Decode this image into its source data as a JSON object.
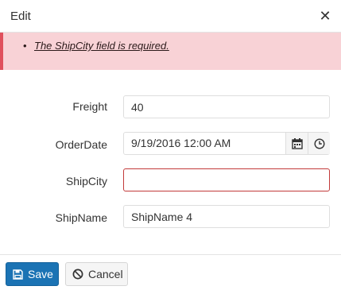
{
  "dialog": {
    "title": "Edit",
    "close_icon": "close-icon"
  },
  "validation": {
    "messages": [
      "The ShipCity field is required."
    ],
    "color": "#e0505d",
    "background": "#f8d2d6"
  },
  "form": {
    "freight": {
      "label": "Freight",
      "value": "40"
    },
    "order_date": {
      "label": "OrderDate",
      "value": "9/19/2016 12:00 AM",
      "calendar_icon": "calendar-icon",
      "clock_icon": "clock-icon"
    },
    "ship_city": {
      "label": "ShipCity",
      "value": ""
    },
    "ship_name": {
      "label": "ShipName",
      "value": "ShipName 4"
    }
  },
  "footer": {
    "save_label": "Save",
    "cancel_label": "Cancel",
    "accent": "#1b73b4"
  }
}
